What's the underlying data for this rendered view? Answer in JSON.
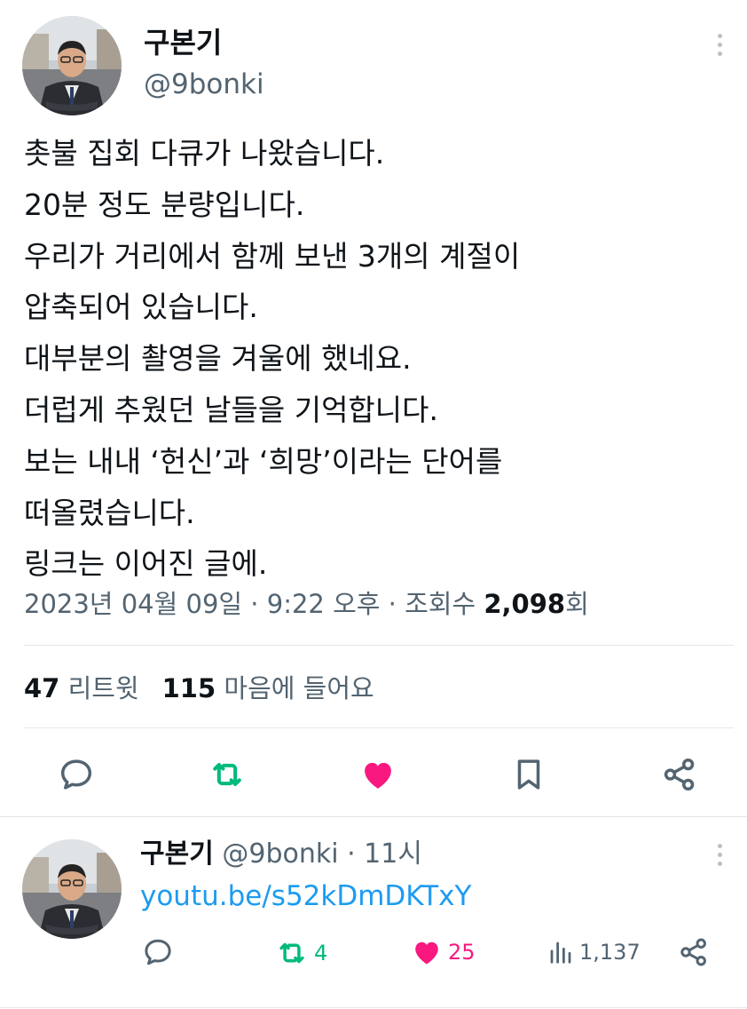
{
  "main_tweet": {
    "author_name": "구본기",
    "author_handle": "@9bonki",
    "text_lines": [
      "촛불 집회 다큐가 나왔습니다.",
      "20분 정도 분량입니다.",
      "우리가 거리에서 함께 보낸 3개의 계절이",
      "압축되어 있습니다.",
      "대부분의 촬영을 겨울에 했네요.",
      "더럽게 추웠던 날들을 기억합니다.",
      "보는 내내 ‘헌신’과 ‘희망’이라는 단어를",
      "떠올렸습니다.",
      "링크는 이어진 글에."
    ],
    "timestamp": "2023년 04월 09일 · 9:22 오후 · 조회수 ",
    "views_count": "2,098",
    "views_suffix": "회",
    "retweets_count": "47",
    "retweets_label": "리트윗",
    "likes_count": "115",
    "likes_label": "마음에 들어요"
  },
  "reply_tweet": {
    "author_name": "구본기",
    "author_handle": "@9bonki",
    "time": " · 11시",
    "link_text": "youtu.be/s52kDmDKTxY",
    "retweets": "4",
    "likes": "25",
    "views": "1,137"
  },
  "icons": {
    "reply": "reply-icon",
    "retweet": "retweet-icon",
    "like": "heart-icon",
    "bookmark": "bookmark-icon",
    "share": "share-icon",
    "views": "views-icon",
    "more": "more-icon"
  },
  "colors": {
    "text_primary": "#0f1419",
    "text_secondary": "#536471",
    "link": "#1d9bf0",
    "retweet_green": "#00ba7c",
    "like_pink": "#f91880",
    "icon_gray": "#536471",
    "divider": "#e4e8eb"
  }
}
